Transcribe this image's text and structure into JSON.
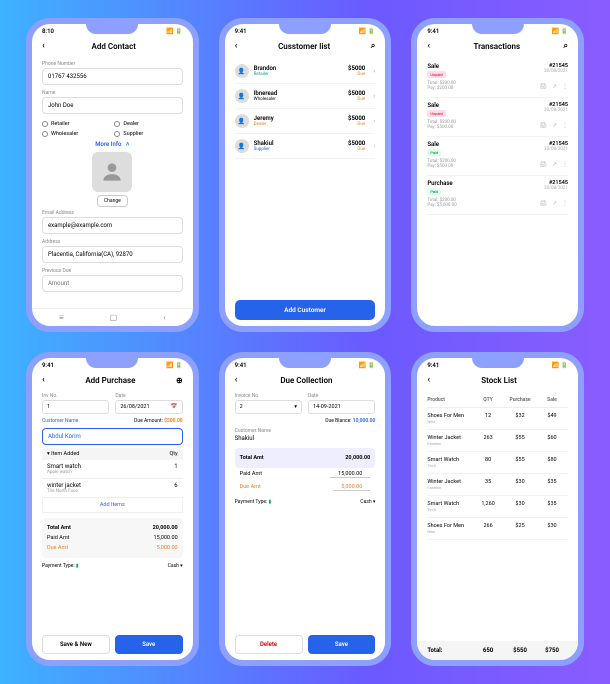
{
  "status": {
    "time": "9:41",
    "alt_time": "8:10"
  },
  "s1": {
    "title": "Add Contact",
    "phone_lbl": "Phone Number",
    "phone": "01767 432556",
    "name_lbl": "Name",
    "name": "John Doe",
    "r1": "Retailer",
    "r2": "Dealer",
    "r3": "Wholesaler",
    "r4": "Supplier",
    "more": "More Info",
    "change": "Change",
    "email_lbl": "Email Address",
    "email": "example@example.com",
    "addr_lbl": "Address",
    "addr": "Placentia, California(CA), 92870",
    "prev_lbl": "Previous Due",
    "prev": "Amount"
  },
  "s2": {
    "title": "Cusstomer list",
    "rows": [
      {
        "name": "Brandon",
        "role": "Retailer",
        "rc": "green",
        "amt": "$5000",
        "sub": "Due"
      },
      {
        "name": "Ibneread",
        "role": "Wholesaler",
        "rc": "",
        "amt": "$5000",
        "sub": "Due"
      },
      {
        "name": "Jeremy",
        "role": "Dealer",
        "rc": "orange",
        "amt": "$5000",
        "sub": "Due"
      },
      {
        "name": "Shakiul",
        "role": "Supplier",
        "rc": "blue",
        "amt": "$5000",
        "sub": "Due"
      }
    ],
    "add": "Add Customer"
  },
  "s3": {
    "title": "Transactions",
    "rows": [
      {
        "type": "Sale",
        "badge": "Unpaid",
        "bc": "bred",
        "id": "#21545",
        "date": "30/08/2021",
        "l1": "Total: $200.00",
        "l2": "Pay: $200.00"
      },
      {
        "type": "Sale",
        "badge": "Unpaid",
        "bc": "bred",
        "id": "#21545",
        "date": "30/08/2021",
        "l1": "Total: $200.00",
        "l2": "Pay: $500.00"
      },
      {
        "type": "Sale",
        "badge": "Paid",
        "bc": "bgreen",
        "id": "#21545",
        "date": "30/08/2021",
        "l1": "Total: $200.00",
        "l2": "Pay: $500.00"
      },
      {
        "type": "Purchase",
        "badge": "Paid",
        "bc": "bgreen",
        "id": "#21545",
        "date": "30/08/2021",
        "l1": "Total: $200.00",
        "l2": "Pay: $5,000.00"
      }
    ]
  },
  "s4": {
    "title": "Add Purchase",
    "inv_lbl": "Inv No.",
    "inv": "1",
    "date_lbl": "Date",
    "date": "26/08/2021",
    "cust_lbl": "Customer Name",
    "due_lbl": "Due Amount:",
    "due_amt": "$500.00",
    "cust": "Abdul Korim",
    "item_hd": "Item Added",
    "qty": "Qty",
    "items": [
      {
        "n": "Smart watch",
        "s": "Apple watch",
        "q": "1"
      },
      {
        "n": "winter jacket",
        "s": "The North Face",
        "q": "6"
      }
    ],
    "add": "Add Items",
    "t1": "Total Amt",
    "v1": "20,000.00",
    "t2": "Paid Amt",
    "v2": "15,000.00",
    "t3": "Due Amt",
    "v3": "5,000.00",
    "pay": "Payment Type:",
    "cash": "Cash",
    "b1": "Save & New",
    "b2": "Save"
  },
  "s5": {
    "title": "Due Collection",
    "inv_lbl": "Invoice No.",
    "inv": "2",
    "date_lbl": "Date",
    "date": "14-09-2021",
    "bal_lbl": "Due Blance:",
    "bal": "10,000.00",
    "cust_lbl": "Customer Name",
    "cust": "Shakiul",
    "t1": "Total Amt",
    "v1": "20,000.00",
    "t2": "Paid Amt",
    "v2": "15,000.00",
    "t3": "Due Amt",
    "v3": "5,000.00",
    "pay": "Payment Type:",
    "cash": "Cash",
    "b1": "Delete",
    "b2": "Save"
  },
  "s6": {
    "title": "Stock List",
    "h1": "Product",
    "h2": "QTY",
    "h3": "Purchase",
    "h4": "Sale",
    "rows": [
      {
        "n": "Shoes For Men",
        "s": "Nike",
        "q": "12",
        "p": "$32",
        "sl": "$49"
      },
      {
        "n": "Winter Jacket",
        "s": "Fashion",
        "q": "263",
        "p": "$55",
        "sl": "$60"
      },
      {
        "n": "Smart Watch",
        "s": "Tech",
        "q": "80",
        "p": "$55",
        "sl": "$80"
      },
      {
        "n": "Winter Jacket",
        "s": "Fashion",
        "q": "35",
        "p": "$30",
        "sl": "$35"
      },
      {
        "n": "Smart Watch",
        "s": "Tech",
        "q": "1,260",
        "p": "$30",
        "sl": "$35"
      },
      {
        "n": "Shoes For Men",
        "s": "Nike",
        "q": "266",
        "p": "$25",
        "sl": "$30"
      }
    ],
    "ft": "Total:",
    "fq": "650",
    "fp": "$550",
    "fs": "$750"
  }
}
